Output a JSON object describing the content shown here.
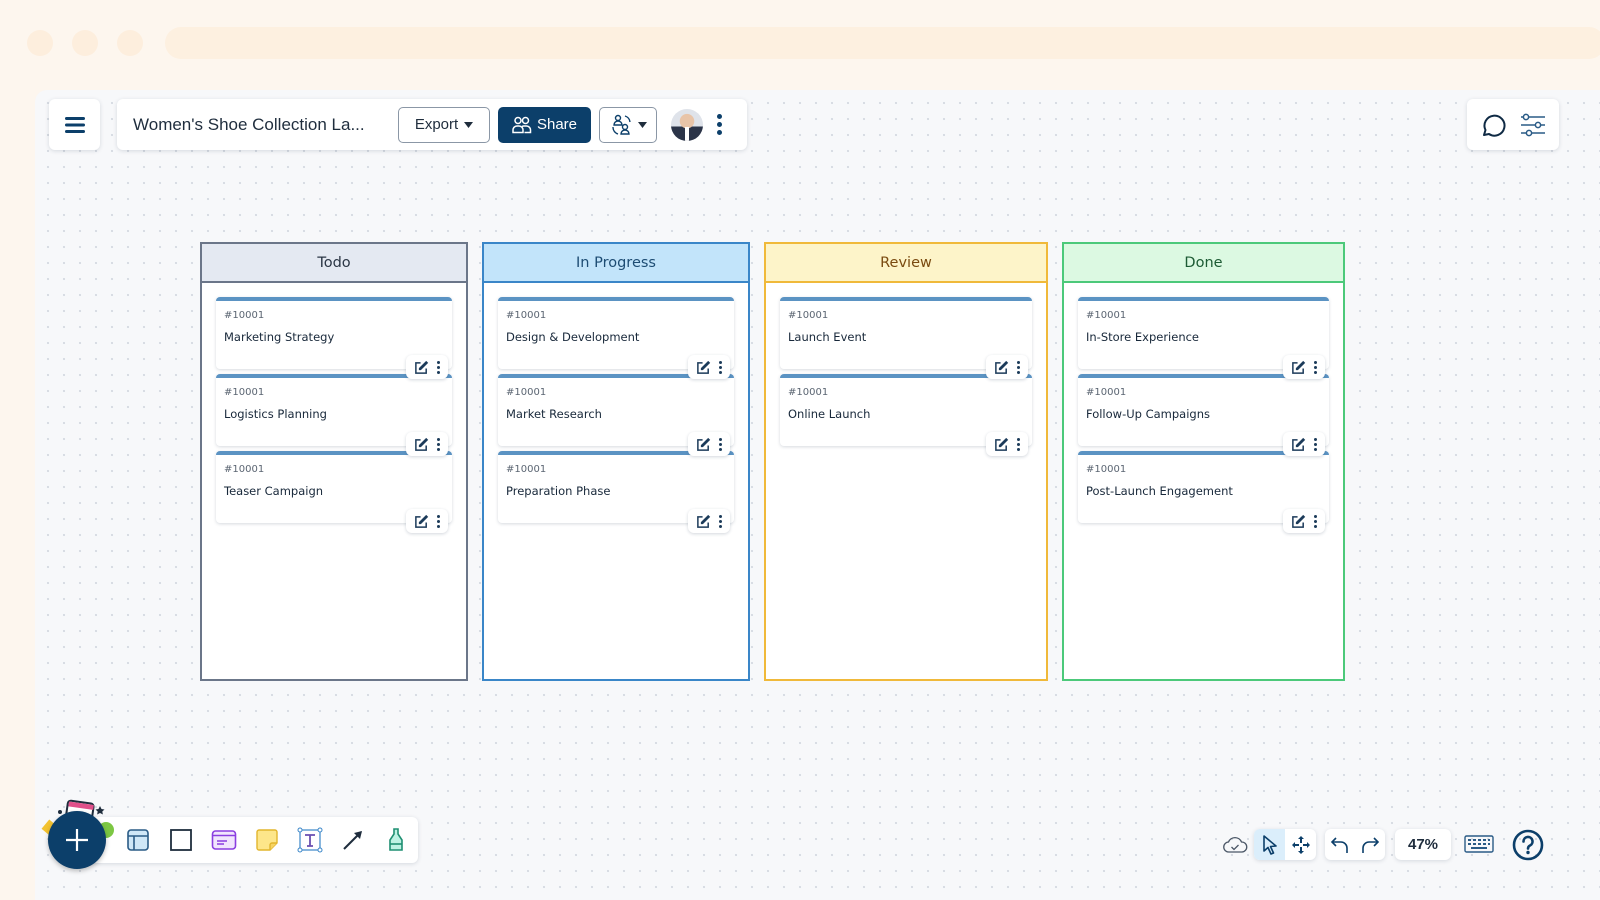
{
  "header": {
    "doc_title": "Women's Shoe Collection La...",
    "export_label": "Export",
    "share_label": "Share"
  },
  "icons": {
    "menu": "hamburger-menu-icon",
    "comment": "comment-icon",
    "settings": "sliders-icon"
  },
  "board": {
    "columns": [
      {
        "title": "Todo",
        "cards": [
          {
            "id": "#10001",
            "title": "Marketing Strategy"
          },
          {
            "id": "#10001",
            "title": "Logistics Planning"
          },
          {
            "id": "#10001",
            "title": "Teaser Campaign"
          }
        ]
      },
      {
        "title": "In Progress",
        "cards": [
          {
            "id": "#10001",
            "title": "Design & Development"
          },
          {
            "id": "#10001",
            "title": "Market Research"
          },
          {
            "id": "#10001",
            "title": "Preparation Phase"
          }
        ]
      },
      {
        "title": "Review",
        "cards": [
          {
            "id": "#10001",
            "title": "Launch Event"
          },
          {
            "id": "#10001",
            "title": "Online Launch"
          }
        ]
      },
      {
        "title": "Done",
        "cards": [
          {
            "id": "#10001",
            "title": "In-Store Experience"
          },
          {
            "id": "#10001",
            "title": "Follow-Up Campaigns"
          },
          {
            "id": "#10001",
            "title": "Post-Launch Engagement"
          }
        ]
      }
    ]
  },
  "toolbar": {
    "tools": [
      "template",
      "rectangle",
      "card",
      "sticky-note",
      "text",
      "arrow",
      "highlighter"
    ]
  },
  "footer": {
    "zoom_level": "47%"
  },
  "colors": {
    "brand": "#0c3f6a",
    "todo": "#6b7689",
    "in_progress": "#3a86c8",
    "review": "#f0b93a",
    "done": "#4cc97a",
    "card_accent": "#5b93c3"
  }
}
